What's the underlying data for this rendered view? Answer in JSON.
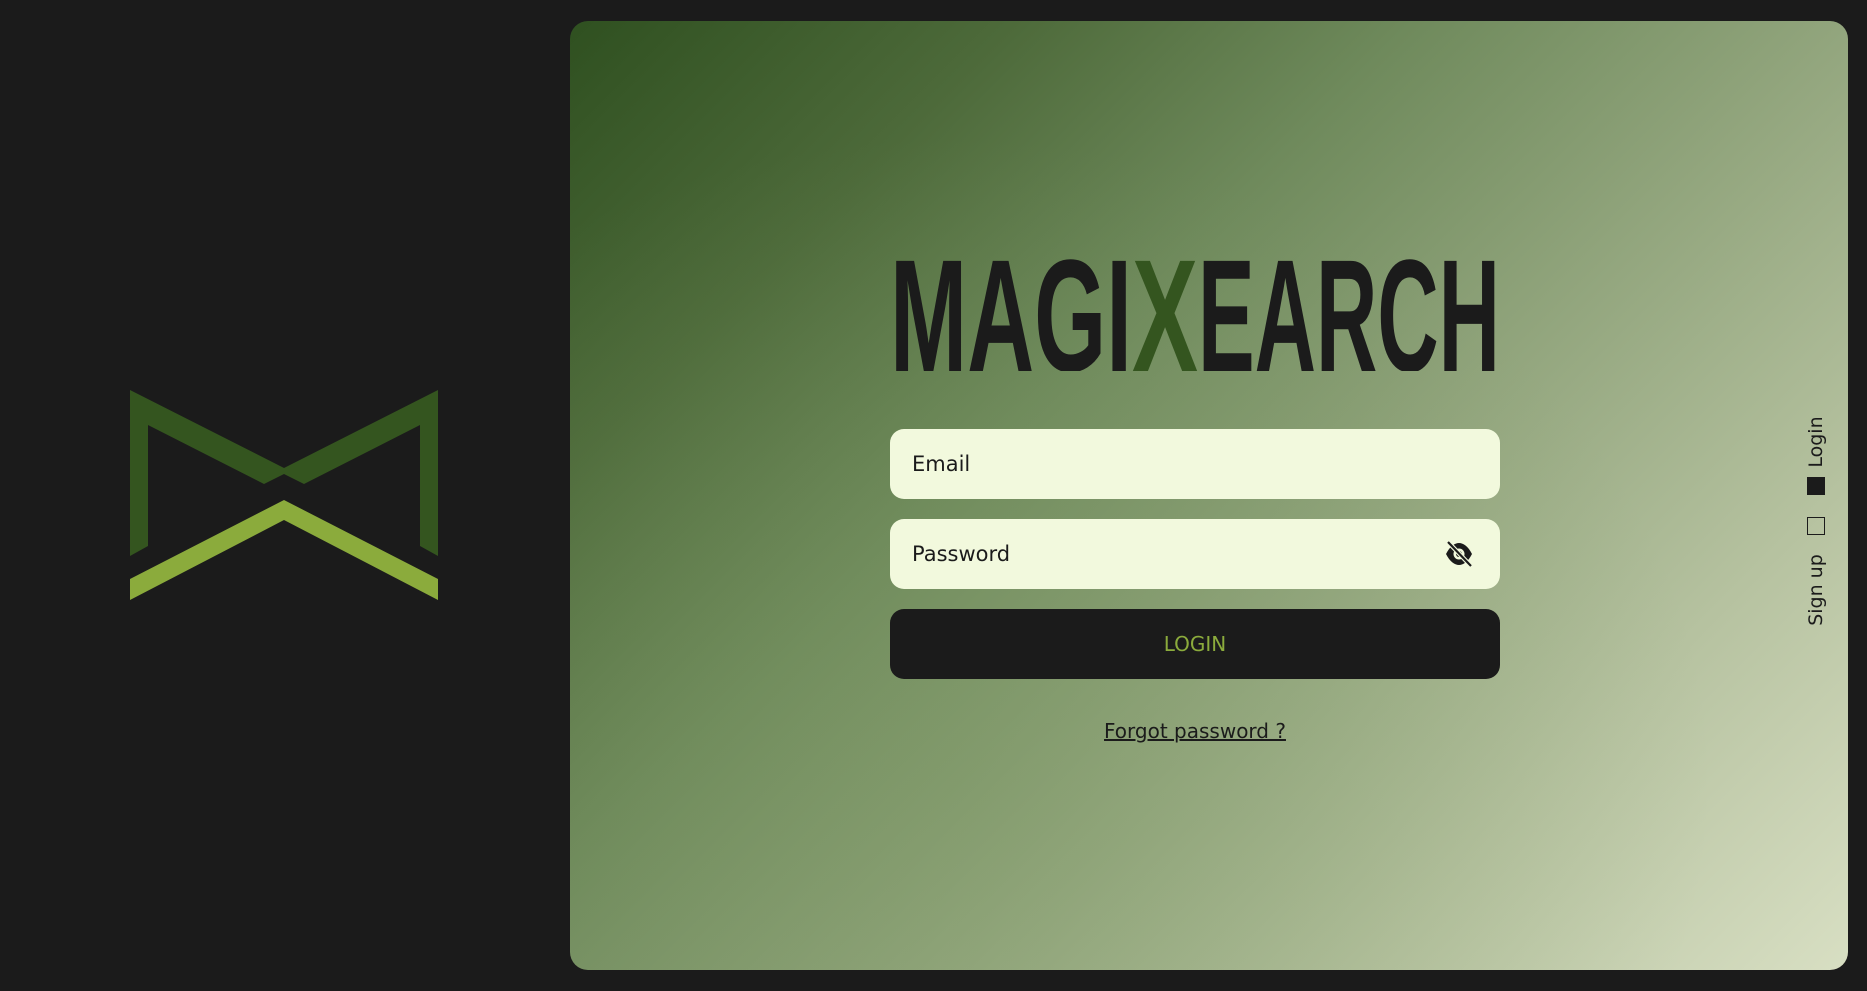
{
  "brand": {
    "logo_icon": "bowtie-chevron-logo",
    "wordmark_left": "MAGI",
    "wordmark_mid": "X",
    "wordmark_right": "EARCH",
    "wordmark_color": "#1b1b1b",
    "accent_dark": "#34551f",
    "accent_light": "#8bab3c"
  },
  "login_form": {
    "email_placeholder": "Email",
    "email_value": "",
    "password_placeholder": "Password",
    "password_value": "",
    "password_visibility_icon": "eye-off-icon",
    "submit_label": "LOGIN",
    "forgot_label": "Forgot password ?"
  },
  "side_nav": {
    "login_label": "Login",
    "signup_label": "Sign up",
    "active_tab": "Login"
  },
  "colors": {
    "background": "#1b1b1b",
    "field_bg": "#f2f9dd",
    "button_bg": "#1b1b1b",
    "button_text": "#8bab3c"
  }
}
